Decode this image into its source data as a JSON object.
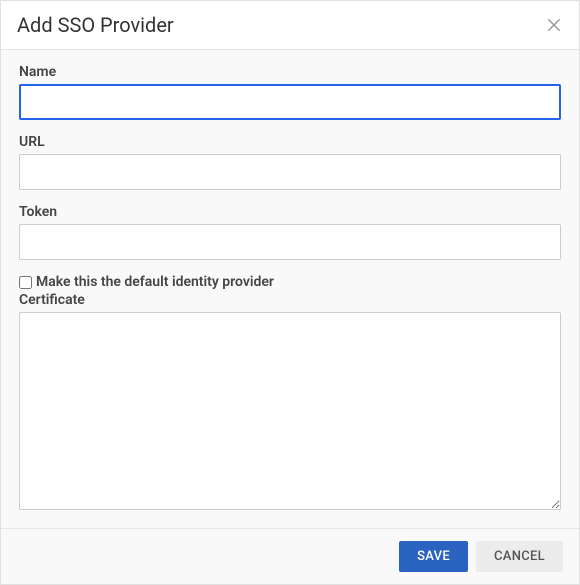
{
  "dialog": {
    "title": "Add SSO Provider"
  },
  "form": {
    "name": {
      "label": "Name",
      "value": ""
    },
    "url": {
      "label": "URL",
      "value": ""
    },
    "token": {
      "label": "Token",
      "value": ""
    },
    "defaultProvider": {
      "label": "Make this the default identity provider",
      "checked": false
    },
    "certificate": {
      "label": "Certificate",
      "value": ""
    }
  },
  "footer": {
    "save_label": "SAVE",
    "cancel_label": "CANCEL"
  }
}
